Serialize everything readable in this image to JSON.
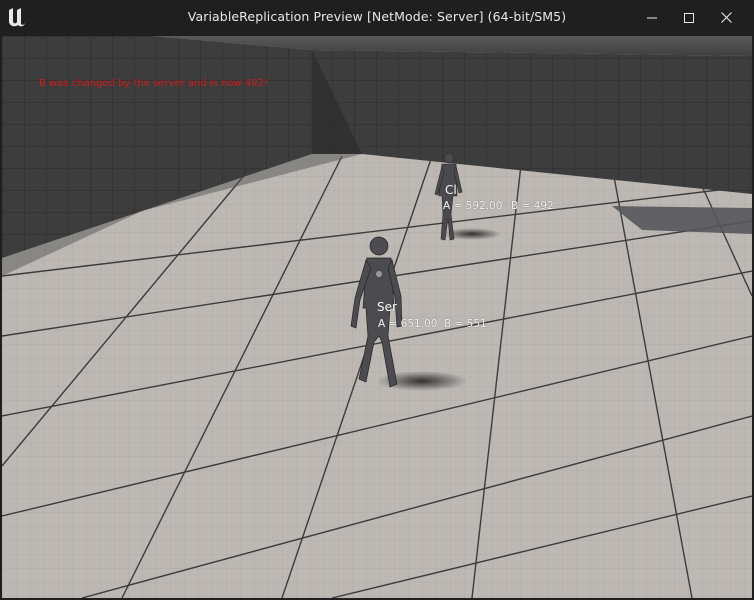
{
  "window": {
    "title": "VariableReplication Preview [NetMode: Server]  (64-bit/SM5)"
  },
  "icons": {
    "app": "unreal-engine-logo-icon",
    "minimize": "minimize-icon",
    "maximize": "maximize-icon",
    "close": "close-icon"
  },
  "viewport": {
    "debug_message": "B was changed by the server and is now 492!",
    "characters": [
      {
        "name": "Cl",
        "a_text": "A = 592.00",
        "b_text": "B = 492"
      },
      {
        "name": "Ser",
        "a_text": "A = 651.00",
        "b_text": "B = 551"
      }
    ]
  },
  "colors": {
    "debug_text": "#d11a1a",
    "titlebar": "#1f1f1f",
    "floor": "#b8b4b0",
    "walls": "#3a3a3a"
  }
}
